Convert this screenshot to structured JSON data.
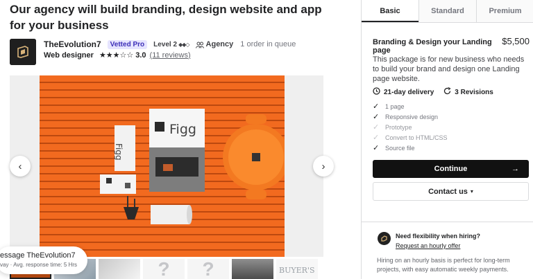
{
  "gig": {
    "title": "Our agency will build branding, design website and app for your business"
  },
  "seller": {
    "name": "TheEvolution7",
    "vetted_badge": "Vetted Pro",
    "level": "Level 2",
    "level_diamonds": "◆◆◇",
    "agency_label": "Agency",
    "queue": "1 order in queue",
    "role": "Web designer",
    "stars": "★★★☆☆",
    "rating": "3.0",
    "reviews": "(11 reviews)"
  },
  "gallery": {
    "prev_icon": "chevron-left-icon",
    "next_icon": "chevron-right-icon",
    "thumb_placeholder": "?",
    "thumb_text": "BUYER'S"
  },
  "chat": {
    "line1": "essage TheEvolution7",
    "line2": "vay  ·  Avg. response time: 5 Hrs"
  },
  "packages": {
    "tabs": [
      {
        "label": "Basic",
        "active": true
      },
      {
        "label": "Standard",
        "active": false
      },
      {
        "label": "Premium",
        "active": false
      }
    ],
    "name": "Branding & Design your Landing page",
    "price": "$5,500",
    "description": "This package is for new business who needs to build your brand and design one Landing page website.",
    "delivery": "21-day delivery",
    "revisions": "3 Revisions",
    "features": [
      {
        "label": "1 page",
        "included": true
      },
      {
        "label": "Responsive design",
        "included": true
      },
      {
        "label": "Prototype",
        "included": false
      },
      {
        "label": "Convert to HTML/CSS",
        "included": false
      },
      {
        "label": "Source file",
        "included": true
      }
    ],
    "continue_label": "Continue",
    "contact_label": "Contact us"
  },
  "hourly": {
    "title": "Need flexibility when hiring?",
    "link": "Request an hourly offer",
    "text": "Hiring on an hourly basis is perfect for long-term projects, with easy automatic weekly payments."
  },
  "colors": {
    "accent_dark": "#111111",
    "vetted_bg": "#e6e4ff",
    "vetted_text": "#3d2fb8",
    "gallery_orange": "#f26a1f"
  }
}
